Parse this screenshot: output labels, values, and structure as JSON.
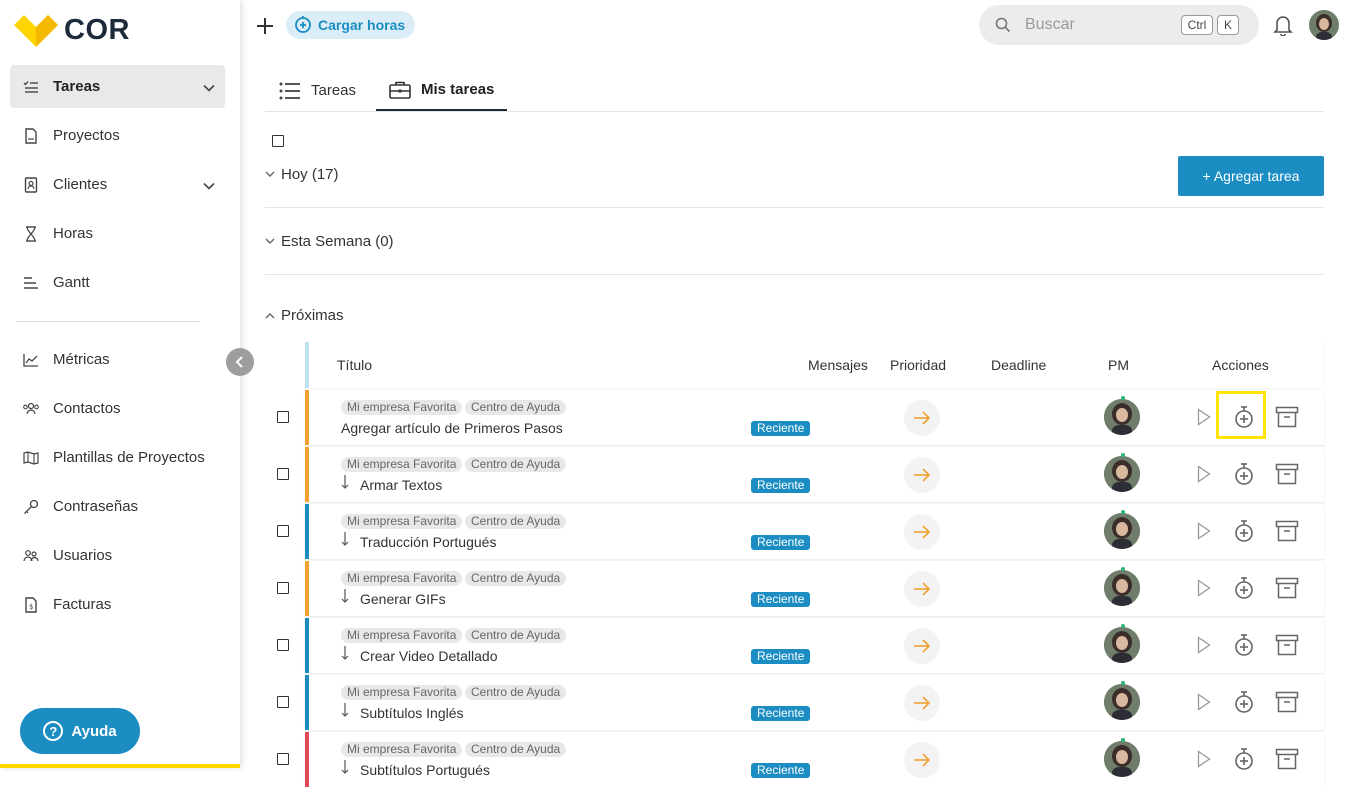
{
  "app": {
    "logo": "COR"
  },
  "sidebar": {
    "items": [
      {
        "label": "Tareas",
        "icon": "task-list-icon",
        "active": true,
        "expandable": true
      },
      {
        "label": "Proyectos",
        "icon": "project-icon"
      },
      {
        "label": "Clientes",
        "icon": "client-icon",
        "expandable": true
      },
      {
        "label": "Horas",
        "icon": "hourglass-icon"
      },
      {
        "label": "Gantt",
        "icon": "gantt-icon"
      },
      {
        "label": "Métricas",
        "icon": "metrics-icon"
      },
      {
        "label": "Contactos",
        "icon": "contacts-icon"
      },
      {
        "label": "Plantillas de Proyectos",
        "icon": "map-icon"
      },
      {
        "label": "Contraseñas",
        "icon": "key-icon"
      },
      {
        "label": "Usuarios",
        "icon": "users-icon"
      },
      {
        "label": "Facturas",
        "icon": "invoice-icon"
      }
    ],
    "help_label": "Ayuda"
  },
  "topbar": {
    "cargar_label": "Cargar horas",
    "search_placeholder": "Buscar",
    "shortcut_keys": [
      "Ctrl",
      "K"
    ]
  },
  "tabs": [
    {
      "label": "Tareas",
      "icon": "list-icon",
      "active": false
    },
    {
      "label": "Mis tareas",
      "icon": "briefcase-icon",
      "active": true
    }
  ],
  "add_task_label": "+ Agregar tarea",
  "sections": [
    {
      "label": "Hoy (17)",
      "expanded": false
    },
    {
      "label": "Esta Semana (0)",
      "expanded": false
    },
    {
      "label": "Próximas",
      "expanded": true
    }
  ],
  "table": {
    "headers": [
      "Título",
      "Mensajes",
      "Prioridad",
      "Deadline",
      "PM",
      "Acciones"
    ],
    "rows": [
      {
        "tags": [
          "Mi empresa Favorita",
          "Centro de Ayuda"
        ],
        "title": "Agregar artículo de Primeros Pasos",
        "subtask": false,
        "badge": "Reciente",
        "color": "#f0a132"
      },
      {
        "tags": [
          "Mi empresa Favorita",
          "Centro de Ayuda"
        ],
        "title": "Armar Textos",
        "subtask": true,
        "badge": "Reciente",
        "color": "#f0a132"
      },
      {
        "tags": [
          "Mi empresa Favorita",
          "Centro de Ayuda"
        ],
        "title": "Traducción Portugués",
        "subtask": true,
        "badge": "Reciente",
        "color": "#1b8dc3"
      },
      {
        "tags": [
          "Mi empresa Favorita",
          "Centro de Ayuda"
        ],
        "title": "Generar GIFs",
        "subtask": true,
        "badge": "Reciente",
        "color": "#f0a132"
      },
      {
        "tags": [
          "Mi empresa Favorita",
          "Centro de Ayuda"
        ],
        "title": "Crear Video Detallado",
        "subtask": true,
        "badge": "Reciente",
        "color": "#1b8dc3"
      },
      {
        "tags": [
          "Mi empresa Favorita",
          "Centro de Ayuda"
        ],
        "title": "Subtítulos Inglés",
        "subtask": true,
        "badge": "Reciente",
        "color": "#1b8dc3"
      },
      {
        "tags": [
          "Mi empresa Favorita",
          "Centro de Ayuda"
        ],
        "title": "Subtítulos Portugués",
        "subtask": true,
        "badge": "Reciente",
        "color": "#e0485a"
      }
    ]
  },
  "colors": {
    "accent": "#1b8dc3",
    "logo_yellow": "#ffd400",
    "highlight": "#ffe500",
    "arrow": "#f0a132"
  }
}
